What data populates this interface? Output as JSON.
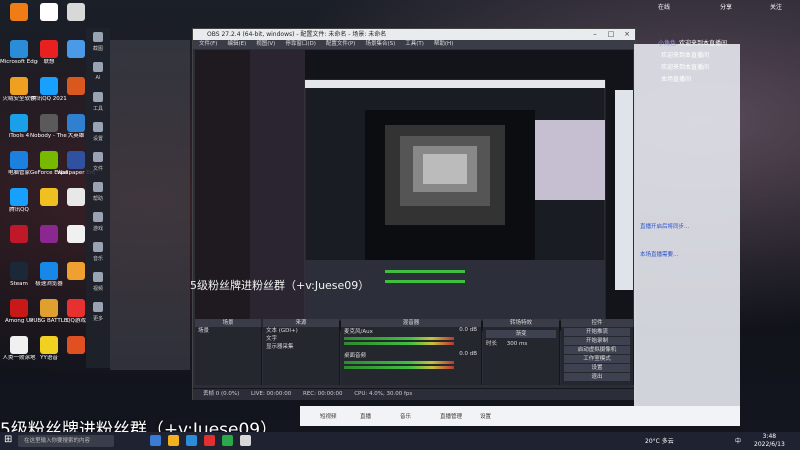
{
  "desktop": {
    "icons_col1": [
      {
        "label": "",
        "color": "#f07c18"
      },
      {
        "label": "Microsoft Edge",
        "color": "#2b8cd8"
      },
      {
        "label": "火绒安全软件",
        "color": "#f0a020"
      },
      {
        "label": "iTools 4",
        "color": "#1aa0e8"
      },
      {
        "label": "电脑管家",
        "color": "#1c80e0"
      },
      {
        "label": "腾讯QQ",
        "color": "#18a0ff"
      },
      {
        "label": "",
        "color": "#c01828"
      },
      {
        "label": "Steam",
        "color": "#1b2838"
      },
      {
        "label": "Among Us",
        "color": "#c81818"
      },
      {
        "label": "人类一败涂地",
        "color": "#f0f0f0"
      }
    ],
    "icons_col2": [
      {
        "label": "",
        "color": "#ffffff"
      },
      {
        "label": "联想",
        "color": "#e82020"
      },
      {
        "label": "腾讯QQ 2021",
        "color": "#18a0ff"
      },
      {
        "label": "Nobody - The Turna...",
        "color": "#5a5a5a"
      },
      {
        "label": "GeForce Experience",
        "color": "#76b900"
      },
      {
        "label": "",
        "color": "#f0c020"
      },
      {
        "label": "",
        "color": "#8a2890"
      },
      {
        "label": "极速浏览器",
        "color": "#1888e8"
      },
      {
        "label": "PUBG BATTLEGR...",
        "color": "#e0a030"
      },
      {
        "label": "YY语音",
        "color": "#f0d020"
      }
    ],
    "icons_col3": [
      {
        "label": "",
        "color": "#d8d8d8"
      },
      {
        "label": "",
        "color": "#4a9ae8"
      },
      {
        "label": "",
        "color": "#d85820"
      },
      {
        "label": "大英雄",
        "color": "#3080d0"
      },
      {
        "label": "Wallpaper Engine",
        "color": "#3050a0"
      },
      {
        "label": "",
        "color": "#e8e8e8"
      },
      {
        "label": "",
        "color": "#f0f0f0"
      },
      {
        "label": "",
        "color": "#f0a030"
      },
      {
        "label": "QQ游戏",
        "color": "#e83030"
      },
      {
        "label": "",
        "color": "#e05020"
      }
    ],
    "side_panel": [
      "截图",
      "AI",
      "工具",
      "设置",
      "文件",
      "帮助",
      "游戏",
      "音乐",
      "视频",
      "更多"
    ]
  },
  "obs": {
    "title": "OBS 27.2.4 (64-bit, windows) - 配置文件: 未命名 - 场景: 未命名",
    "menu": [
      "文件(F)",
      "编辑(E)",
      "视图(V)",
      "停靠窗口(D)",
      "配置文件(P)",
      "场景集合(S)",
      "工具(T)",
      "帮助(H)"
    ],
    "panels": {
      "scenes_header": "场景",
      "sources_header": "来源",
      "mixer_header": "混音器",
      "transitions_header": "转场特效",
      "controls_header": "控件"
    },
    "scenes": [
      "场景"
    ],
    "sources": [
      "文本 (GDI+)",
      "文字",
      "显示器采集"
    ],
    "mixer": [
      {
        "name": "麦克风/Aux",
        "db": "0.0 dB"
      },
      {
        "name": "桌面音频",
        "db": "0.0 dB"
      }
    ],
    "transition": {
      "type": "渐变",
      "duration_label": "时长",
      "duration": "300 ms"
    },
    "controls": [
      "开始推流",
      "开始录制",
      "启动虚拟摄像机",
      "工作室模式",
      "设置",
      "退出"
    ],
    "status": {
      "dropped": "丢帧 0 (0.0%)",
      "live": "LIVE: 00:00:00",
      "rec": "REC: 00:00:00",
      "cpu": "CPU: 4.0%, 30.00 fps"
    }
  },
  "caption": "5级粉丝牌进粉丝群（+v:Juese09）",
  "caption_big": "5级粉丝牌进粉丝群（+v:Juese09）",
  "chat": {
    "top_stats": [
      "在线",
      "分享",
      "关注"
    ],
    "lines": [
      {
        "user": "小角色",
        "text": "欢迎来到本直播间"
      },
      {
        "user": "",
        "text": "欢迎来到本直播间"
      },
      {
        "user": "",
        "text": "欢迎来到本直播间"
      },
      {
        "user": "",
        "text": "本场直播间"
      }
    ]
  },
  "browser": {
    "tabs": [
      "短视频",
      "直播",
      "音乐",
      "直播管理",
      "设置"
    ],
    "note1": "直播开启后将同步...",
    "note2": "本场直播需要..."
  },
  "taskbar": {
    "search": "在这里输入你要搜索的内容",
    "weather": "20°C 多云",
    "lang": "中",
    "time": "3:48",
    "date": "2022/6/13"
  }
}
